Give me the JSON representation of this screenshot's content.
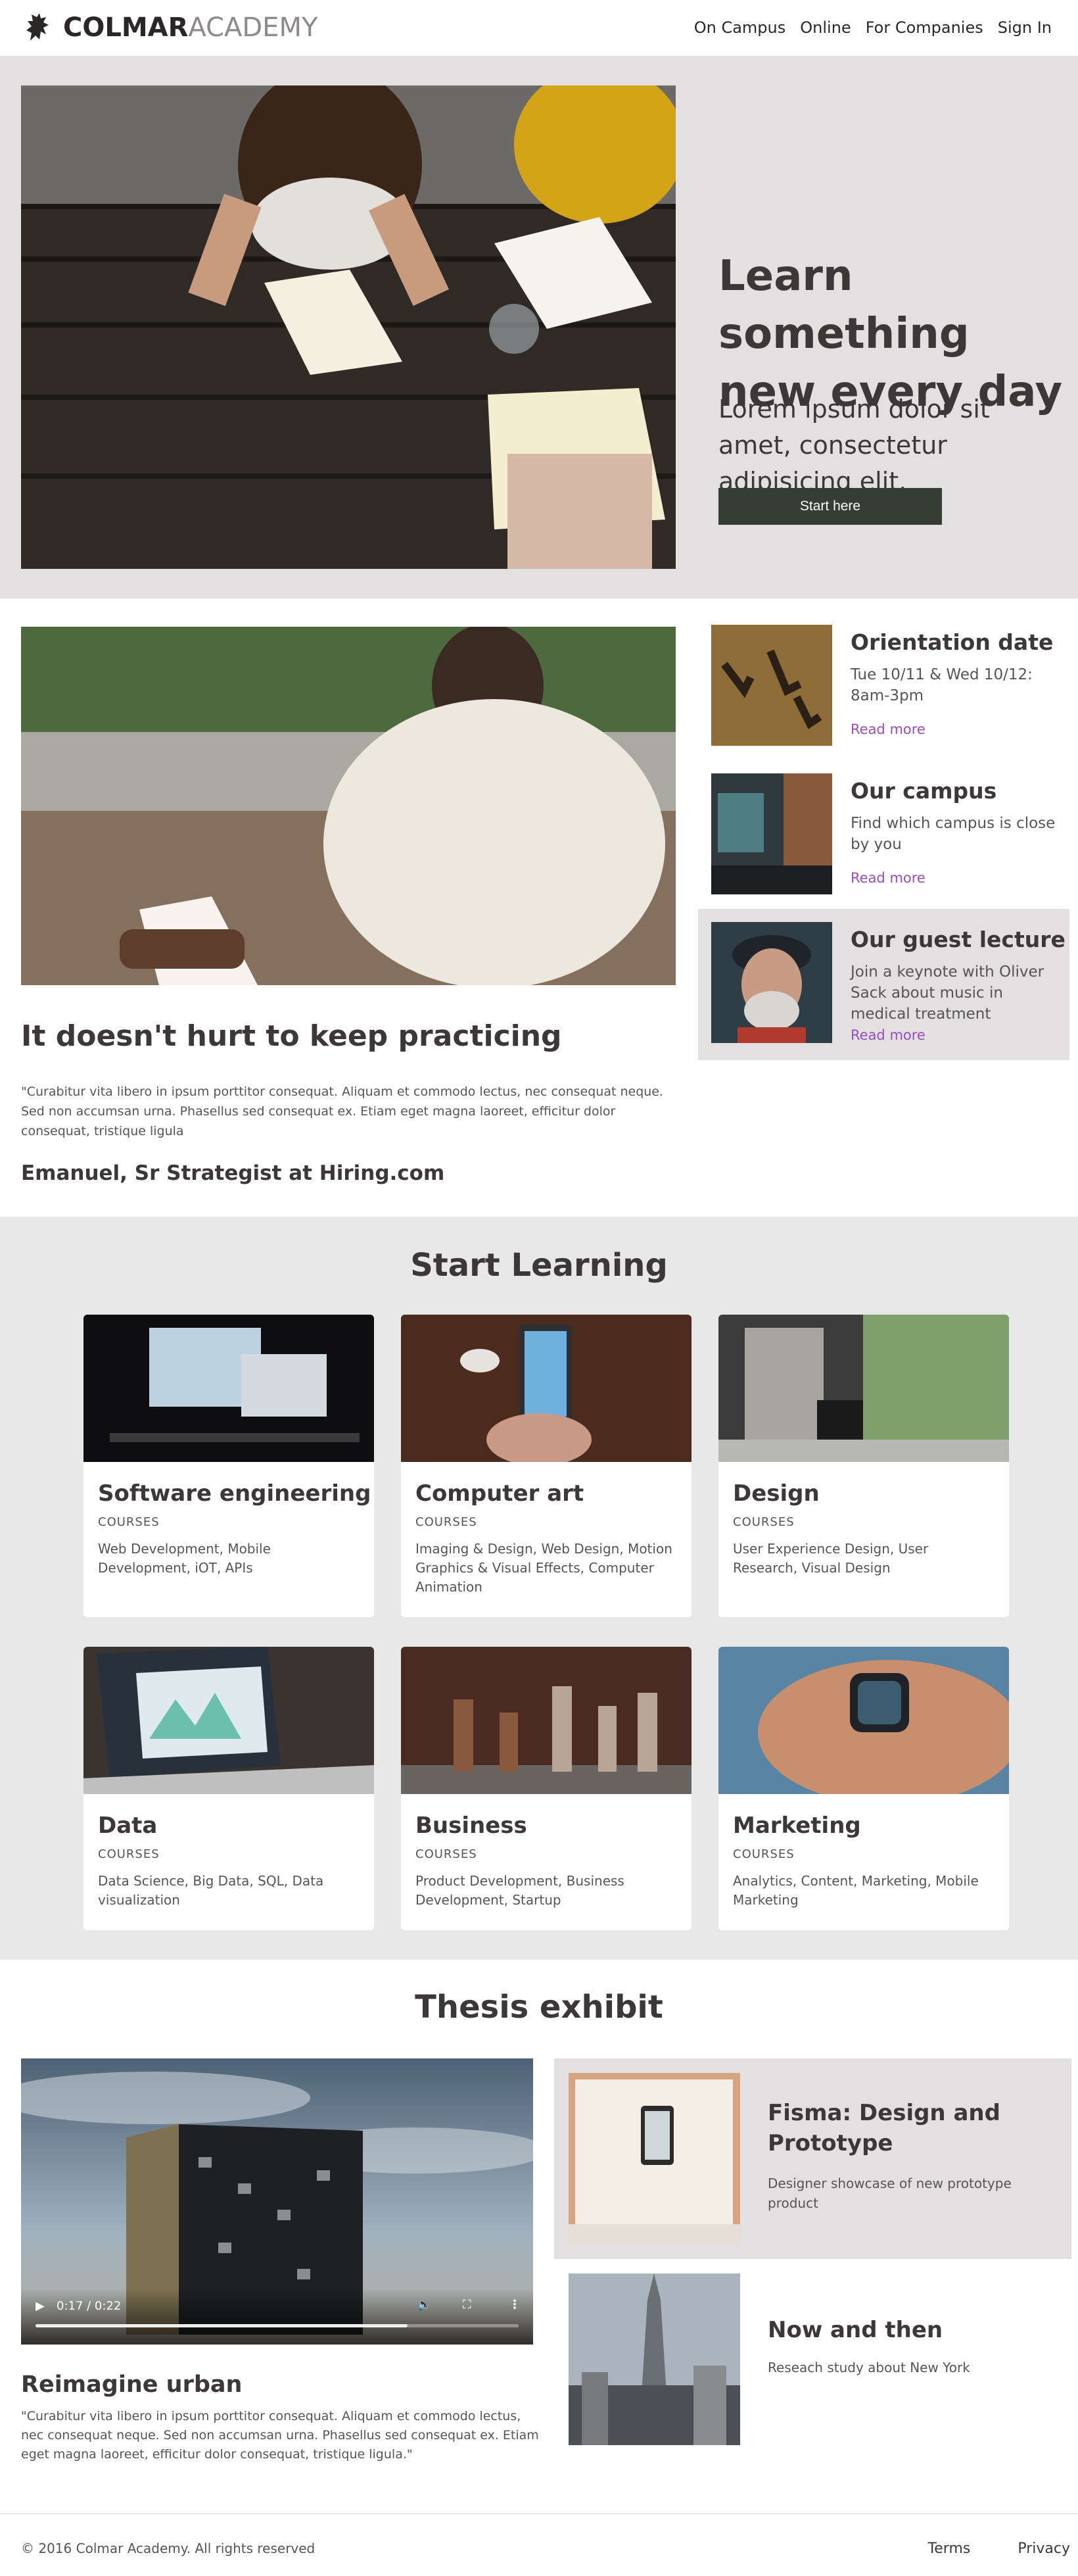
{
  "brand": {
    "bold": "COLMAR",
    "light": "ACADEMY"
  },
  "nav": [
    "On Campus",
    "Online",
    "For Companies",
    "Sign In"
  ],
  "hero": {
    "title": "Learn something new every day",
    "subtitle": "Lorem ipsum dolor sit amet, consectetur adipisicing elit.",
    "button": "Start here"
  },
  "practice": {
    "title": "It doesn't hurt to keep practicing",
    "quote": "\"Curabitur vita libero in ipsum porttitor consequat. Aliquam et commodo lectus, nec consequat neque. Sed non accumsan urna. Phasellus sed consequat ex. Etiam eget magna laoreet, efficitur dolor consequat, tristique ligula",
    "author": "Emanuel, Sr Strategist at Hiring.com"
  },
  "events": [
    {
      "title": "Orientation date",
      "desc": "Tue 10/11 & Wed 10/12: 8am-3pm",
      "link": "Read more"
    },
    {
      "title": "Our campus",
      "desc": "Find which campus is close by you",
      "link": "Read more"
    },
    {
      "title": "Our guest lecture",
      "desc": "Join a keynote with Oliver Sack about music in medical treatment",
      "link": "Read more"
    }
  ],
  "learning": {
    "title": "Start Learning",
    "courses": [
      {
        "title": "Software engineering",
        "kicker": "COURSES",
        "desc": "Web Development, Mobile Development, iOT, APIs"
      },
      {
        "title": "Computer art",
        "kicker": "COURSES",
        "desc": "Imaging & Design, Web Design, Motion Graphics & Visual Effects, Computer Animation"
      },
      {
        "title": "Design",
        "kicker": "COURSES",
        "desc": "User Experience Design, User Research, Visual Design"
      },
      {
        "title": "Data",
        "kicker": "COURSES",
        "desc": "Data Science, Big Data, SQL, Data visualization"
      },
      {
        "title": "Business",
        "kicker": "COURSES",
        "desc": "Product Development, Business Development, Startup"
      },
      {
        "title": "Marketing",
        "kicker": "COURSES",
        "desc": "Analytics, Content, Marketing, Mobile Marketing"
      }
    ]
  },
  "thesis": {
    "title": "Thesis exhibit",
    "video": {
      "time": "0:17 / 0:22",
      "progress": 0.77
    },
    "reimagine_title": "Reimagine urban",
    "reimagine_quote": "\"Curabitur vita libero in ipsum porttitor consequat. Aliquam et commodo lectus, nec consequat neque. Sed non accumsan urna. Phasellus sed consequat ex. Etiam eget magna laoreet, efficitur dolor consequat, tristique ligula.\"",
    "exhibits": [
      {
        "title": "Fisma: Design and Prototype",
        "desc": "Designer showcase of new prototype product"
      },
      {
        "title": "Now and then",
        "desc": "Reseach study about New York"
      }
    ]
  },
  "footer": {
    "copyright": "© 2016 Colmar Academy. All rights reserved",
    "links": [
      "Terms",
      "Privacy"
    ]
  },
  "colors": {
    "accent_link": "#9a4bbf",
    "button_bg": "#353d35",
    "gray_band": "#e2e0e1"
  }
}
